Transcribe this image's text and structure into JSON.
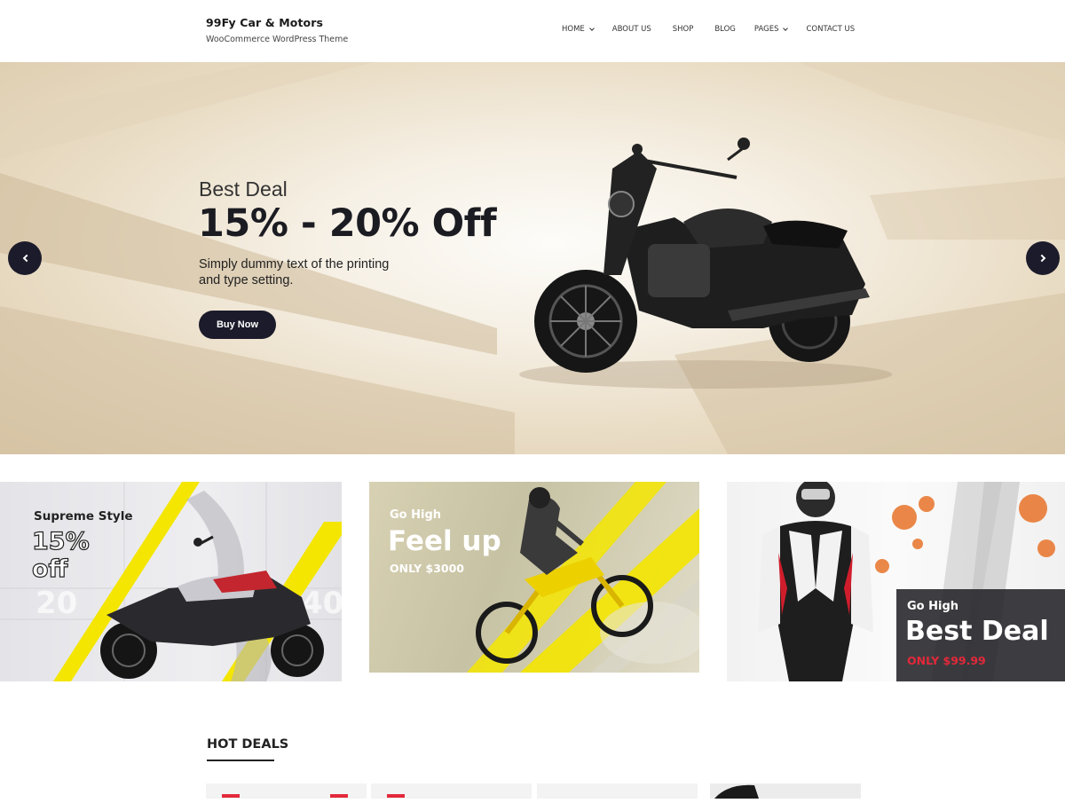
{
  "header": {
    "site_title": "99Fy Car & Motors",
    "tagline": "WooCommerce WordPress Theme",
    "nav": [
      {
        "label": "HOME",
        "has_dropdown": true
      },
      {
        "label": "ABOUT US",
        "has_dropdown": false
      },
      {
        "label": "SHOP",
        "has_dropdown": false
      },
      {
        "label": "BLOG",
        "has_dropdown": false
      },
      {
        "label": "PAGES",
        "has_dropdown": true
      },
      {
        "label": "CONTACT US",
        "has_dropdown": false
      }
    ]
  },
  "hero": {
    "subtitle": "Best Deal",
    "title": "15% - 20% Off",
    "description": "Simply dummy text of the printing and type setting.",
    "button_label": "Buy Now",
    "prev_icon": "chevron-left-icon",
    "next_icon": "chevron-right-icon"
  },
  "promos": [
    {
      "eyebrow": "Supreme Style",
      "headline_line1": "15%",
      "headline_line2": "off",
      "price": ""
    },
    {
      "eyebrow": "Go High",
      "headline": "Feel up",
      "price": "ONLY $3000"
    },
    {
      "eyebrow": "Go High",
      "headline": "Best Deal",
      "price": "ONLY $99.99"
    }
  ],
  "hot_deals": {
    "title": "HOT DEALS"
  },
  "colors": {
    "dark": "#1c1b2b",
    "accent_yellow": "#f4e600",
    "accent_red": "#e3283a"
  }
}
